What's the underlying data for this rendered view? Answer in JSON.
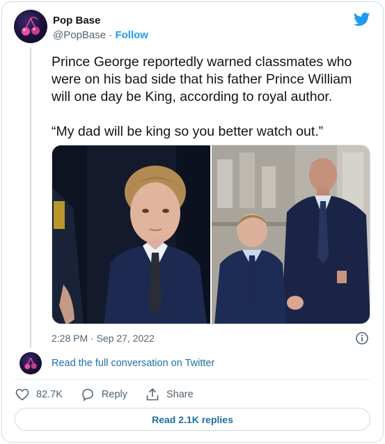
{
  "author": {
    "name": "Pop Base",
    "handle": "@PopBase",
    "separator": "·",
    "follow_label": "Follow",
    "avatar_icon": "cherry-logo-icon"
  },
  "tweet": {
    "paragraphs": [
      "Prince George reportedly warned classmates who were on his bad side that his father Prince William will one day be King, according to royal author.",
      "“My dad will be king so you better watch out.”"
    ],
    "timestamp": "2:28 PM · Sep 27, 2022"
  },
  "conversation": {
    "read_full_label": "Read the full conversation on Twitter"
  },
  "actions": {
    "likes_count": "82.7K",
    "reply_label": "Reply",
    "share_label": "Share"
  },
  "replies": {
    "read_label": "Read 2.1K replies"
  },
  "colors": {
    "brand": "#1d9bf0",
    "link": "#1d6fa5",
    "secondary_text": "#536471",
    "border": "#cfd9de"
  }
}
